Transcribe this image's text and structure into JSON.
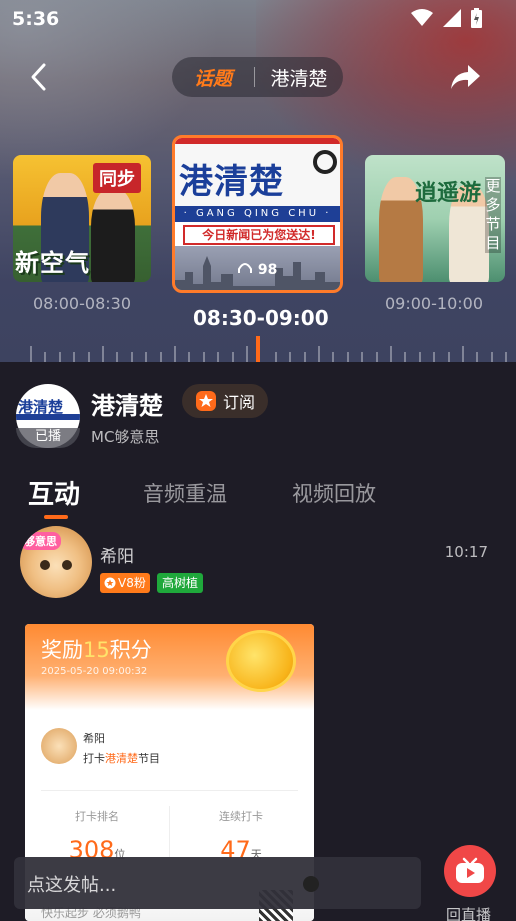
{
  "status_bar": {
    "time": "5:36"
  },
  "header": {
    "topic_tag": "话题",
    "title": "港清楚"
  },
  "carousel": {
    "left": {
      "time": "08:00-08:30",
      "tag_text": "同步",
      "cover_text": "新空气"
    },
    "center": {
      "time": "08:30-09:00",
      "logo_text": "港清楚",
      "pinyin": "· GANG QING CHU ·",
      "banner_text": "今日新闻已为您送达!",
      "listen_count": "98"
    },
    "right": {
      "time": "09:00-10:00",
      "cover_text": "逍遥游",
      "more_label": "更多节目"
    }
  },
  "show": {
    "name": "港清楚",
    "status_badge": "已播",
    "subscribe_label": "订阅",
    "host": "MC够意思",
    "avatar_logo": "港清楚"
  },
  "tabs": [
    {
      "label": "互动"
    },
    {
      "label": "音频重温"
    },
    {
      "label": "视频回放"
    }
  ],
  "post": {
    "username": "希阳",
    "time": "10:17",
    "fan_badge": "V8粉",
    "tree_badge": "高树植",
    "avatar_sticker": "够意思",
    "reward_card": {
      "title_prefix": "奖励",
      "points": "15",
      "title_suffix": "积分",
      "date": "2025-05-20 09:00:32",
      "user": "希阳",
      "checkin_prefix": "打卡",
      "checkin_show": "港清楚",
      "checkin_suffix": "节目",
      "rank_label": "打卡排名",
      "rank_value": "308",
      "rank_unit": "位",
      "streak_label": "连续打卡",
      "streak_value": "47",
      "streak_unit": "天",
      "slogan": "快乐起步 必须鹅鸭"
    }
  },
  "composer": {
    "placeholder": "点这发帖..."
  },
  "live_button": {
    "label": "回直播"
  },
  "colors": {
    "accent": "#ff6a1a",
    "live_red": "#f04747",
    "badge_green": "#1fa83b"
  }
}
